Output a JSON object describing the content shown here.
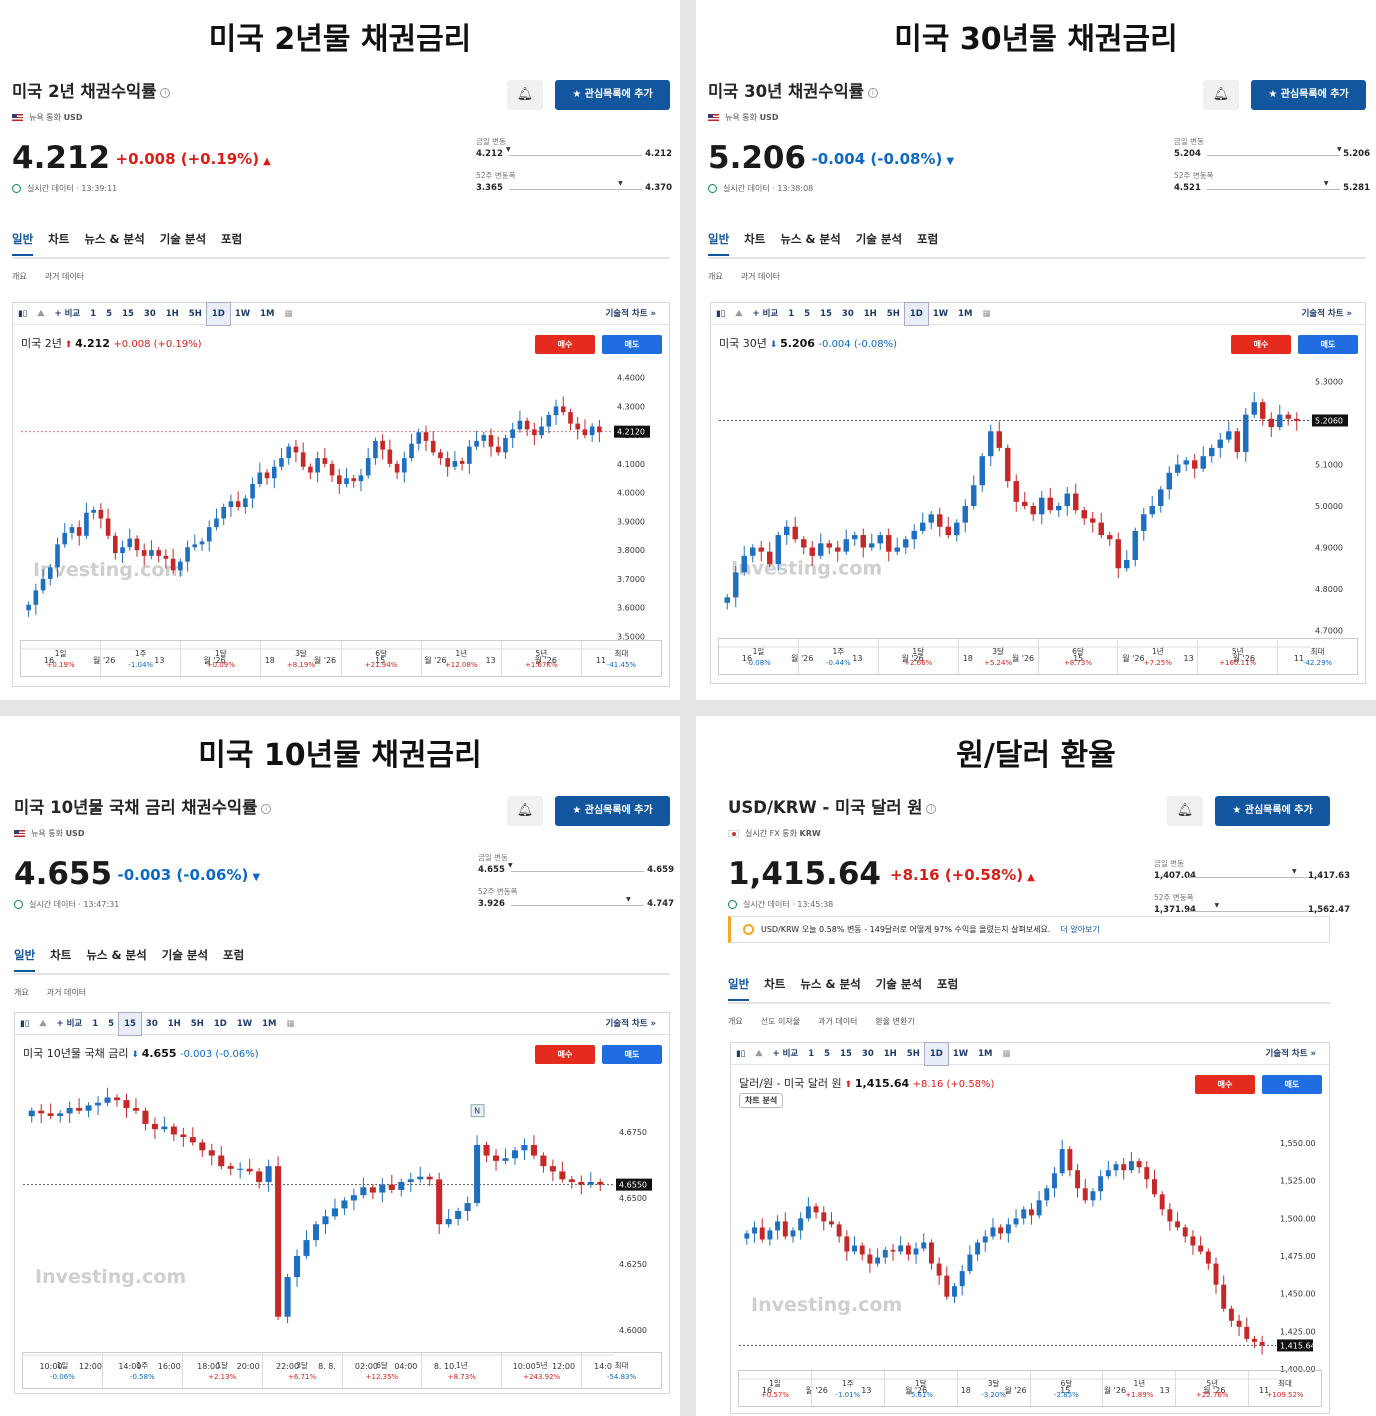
{
  "periods_labels": [
    "1일",
    "1주",
    "1달",
    "3달",
    "6달",
    "1년",
    "5년",
    "최대"
  ],
  "colors": {
    "up": "#d91e18",
    "down": "#0d69c4",
    "candle_up": "#1f6fbf",
    "candle_down": "#c62828",
    "accent": "#1256a0"
  },
  "common": {
    "currency_label": "통화",
    "daily_range_label": "금일 변동",
    "week52_label": "52주 변동폭",
    "watchlist_btn": "관심목록에 추가",
    "tabs": [
      "일반",
      "차트",
      "뉴스 & 분석",
      "기술 분석",
      "포럼"
    ],
    "subtabs": [
      "개요",
      "과거 데이터"
    ],
    "sell": "매수",
    "buy": "매도",
    "compare": "+ 비교",
    "tech_chart": "기술적 차트 »",
    "watermark": "Investing.com",
    "time_buttons": [
      "1",
      "5",
      "15",
      "30",
      "1H",
      "5H",
      "1D",
      "1W",
      "1M"
    ]
  },
  "panels": [
    {
      "section_title": "미국 2년물 채권금리",
      "name": "미국 2년 채권수익률",
      "exchange": "뉴욕",
      "currency": "USD",
      "price": "4.212",
      "change": "+0.008",
      "change_pct": "(+0.19%)",
      "direction": "up",
      "status": "실시간 데이터 · 13:39:11",
      "day_low": "4.212",
      "day_high": "4.212",
      "w52_low": "3.365",
      "w52_high": "4.370",
      "legend_name": "미국 2년",
      "legend_price": "4.212",
      "legend_change": "+0.008 (+0.19%)",
      "selected_interval": "1D",
      "periods": [
        "+0.19%",
        "-1.04%",
        "+0.09%",
        "+8.19%",
        "+21.94%",
        "+12.08%",
        "+1.67K%",
        "-41.45%"
      ],
      "chart_data": {
        "type": "candlestick",
        "interval": "1D",
        "yticks": [
          "4.4000",
          "4.3000",
          "4.2000",
          "4.1000",
          "4.0000",
          "3.9000",
          "3.8000",
          "3.7000",
          "3.6000",
          "3.5000"
        ],
        "ylim": [
          3.47,
          4.43
        ],
        "xticks": [
          "16",
          "월 '26",
          "13",
          "월 '26",
          "18",
          "월 '26",
          "15",
          "월 '26",
          "13",
          "월 '26",
          "11"
        ],
        "last_label": "4.2120",
        "last": 4.212,
        "close": [
          3.61,
          3.66,
          3.7,
          3.74,
          3.82,
          3.86,
          3.88,
          3.85,
          3.93,
          3.94,
          3.91,
          3.85,
          3.79,
          3.81,
          3.84,
          3.8,
          3.78,
          3.8,
          3.78,
          3.77,
          3.73,
          3.76,
          3.81,
          3.82,
          3.83,
          3.88,
          3.91,
          3.95,
          3.97,
          3.95,
          3.98,
          4.03,
          4.07,
          4.05,
          4.09,
          4.12,
          4.16,
          4.14,
          4.09,
          4.07,
          4.12,
          4.1,
          4.06,
          4.03,
          4.05,
          4.04,
          4.06,
          4.12,
          4.18,
          4.15,
          4.1,
          4.07,
          4.12,
          4.17,
          4.21,
          4.18,
          4.14,
          4.12,
          4.09,
          4.11,
          4.1,
          4.16,
          4.18,
          4.2,
          4.16,
          4.14,
          4.19,
          4.22,
          4.25,
          4.22,
          4.2,
          4.23,
          4.27,
          4.3,
          4.28,
          4.24,
          4.22,
          4.2,
          4.23,
          4.21
        ]
      }
    },
    {
      "section_title": "미국 30년물 채권금리",
      "name": "미국 30년 채권수익률",
      "exchange": "뉴욕",
      "currency": "USD",
      "price": "5.206",
      "change": "-0.004",
      "change_pct": "(-0.08%)",
      "direction": "down",
      "status": "실시간 데이터 · 13:38:08",
      "day_low": "5.204",
      "day_high": "5.206",
      "w52_low": "4.521",
      "w52_high": "5.281",
      "legend_name": "미국 30년",
      "legend_price": "5.206",
      "legend_change": "-0.004 (-0.08%)",
      "selected_interval": "1D",
      "periods": [
        "-0.08%",
        "-0.44%",
        "+2.66%",
        "+5.24%",
        "+8.73%",
        "+7.25%",
        "+160.11%",
        "-42.29%"
      ],
      "chart_data": {
        "type": "candlestick",
        "interval": "1D",
        "yticks": [
          "5.3000",
          "5.2000",
          "5.1000",
          "5.0000",
          "4.9000",
          "4.8000",
          "4.7000"
        ],
        "ylim": [
          4.67,
          5.33
        ],
        "xticks": [
          "16",
          "월 '26",
          "13",
          "월 '26",
          "18",
          "월 '26",
          "15",
          "월 '26",
          "13",
          "월 '26",
          "11"
        ],
        "last_label": "5.2060",
        "last": 5.206,
        "close": [
          4.78,
          4.84,
          4.88,
          4.9,
          4.89,
          4.86,
          4.93,
          4.95,
          4.92,
          4.9,
          4.88,
          4.91,
          4.9,
          4.89,
          4.92,
          4.93,
          4.9,
          4.91,
          4.93,
          4.89,
          4.9,
          4.92,
          4.94,
          4.96,
          4.98,
          4.95,
          4.93,
          4.96,
          5.0,
          5.05,
          5.12,
          5.18,
          5.14,
          5.06,
          5.01,
          5.0,
          4.98,
          5.02,
          4.99,
          5.0,
          5.03,
          4.99,
          4.97,
          4.96,
          4.93,
          4.92,
          4.85,
          4.87,
          4.94,
          4.98,
          5.0,
          5.04,
          5.08,
          5.1,
          5.11,
          5.09,
          5.12,
          5.14,
          5.16,
          5.18,
          5.13,
          5.22,
          5.25,
          5.21,
          5.19,
          5.22,
          5.21,
          5.205
        ]
      }
    },
    {
      "section_title": "미국 10년물 채권금리",
      "name": "미국 10년물 국채 금리 채권수익률",
      "exchange": "뉴욕",
      "currency": "USD",
      "price": "4.655",
      "change": "-0.003",
      "change_pct": "(-0.06%)",
      "direction": "down",
      "status": "실시간 데이터 · 13:47:31",
      "day_low": "4.655",
      "day_high": "4.659",
      "w52_low": "3.926",
      "w52_high": "4.747",
      "legend_name": "미국 10년물 국채 금리",
      "legend_price": "4.655",
      "legend_change": "-0.003 (-0.06%)",
      "selected_interval": "15",
      "periods": [
        "-0.06%",
        "-0.58%",
        "+2.13%",
        "+6.71%",
        "+12.35%",
        "+8.73%",
        "+243.92%",
        "-54.83%"
      ],
      "chart_data": {
        "type": "candlestick",
        "interval": "15",
        "yticks": [
          "4.6750",
          "4.6500",
          "4.6250",
          "4.6000"
        ],
        "ylim": [
          4.592,
          4.695
        ],
        "xticks": [
          "10:00",
          "12:00",
          "14:00",
          "16:00",
          "18:00",
          "20:00",
          "22:00",
          "8. 8.",
          "02:00",
          "04:00",
          "8. 10.",
          "",
          "10:00",
          "12:00",
          "14:0"
        ],
        "last_label": "4.6550",
        "last": 4.655,
        "news_marker": "N",
        "close": [
          4.683,
          4.682,
          4.681,
          4.682,
          4.684,
          4.683,
          4.685,
          4.686,
          4.688,
          4.687,
          4.684,
          4.683,
          4.678,
          4.676,
          4.677,
          4.674,
          4.673,
          4.671,
          4.668,
          4.666,
          4.662,
          4.661,
          4.661,
          4.66,
          4.656,
          4.662,
          4.605,
          4.62,
          4.628,
          4.634,
          4.64,
          4.643,
          4.646,
          4.649,
          4.651,
          4.654,
          4.652,
          4.655,
          4.653,
          4.656,
          4.657,
          4.658,
          4.657,
          4.64,
          4.642,
          4.645,
          4.648,
          4.67,
          4.666,
          4.664,
          4.665,
          4.668,
          4.67,
          4.666,
          4.662,
          4.66,
          4.657,
          4.656,
          4.655,
          4.656,
          4.655
        ]
      }
    },
    {
      "section_title": "원/달러 환율",
      "name": "USD/KRW - 미국 달러 원",
      "exchange": "실시간 FX",
      "currency": "KRW",
      "price": "1,415.64",
      "change": "+8.16",
      "change_pct": "(+0.58%)",
      "direction": "up",
      "status": "실시간 데이터 · 13:45:38",
      "day_low": "1,407.04",
      "day_high": "1,417.63",
      "w52_low": "1,371.94",
      "w52_high": "1,562.47",
      "legend_name": "달러/원 - 미국 달러 원",
      "legend_price": "1,415.64",
      "legend_change": "+8.16 (+0.58%)",
      "selected_interval": "1D",
      "ai_label": "차트 분석",
      "notice": "USD/KRW 오늘 0.58% 변동 - 149달러로 어떻게 97% 수익을 올렸는지 살펴보세요.",
      "notice_more": "더 알아보기",
      "subtabs": [
        "개요",
        "선도 이자율",
        "과거 데이터",
        "환율 변환기"
      ],
      "periods": [
        "+0.57%",
        "-1.01%",
        "-5.61%",
        "-3.20%",
        "-2.85%",
        "+1.89%",
        "+22.76%",
        "+109.52%"
      ],
      "chart_data": {
        "type": "candlestick",
        "interval": "1D",
        "yticks": [
          "1,550.00",
          "1,525.00",
          "1,500.00",
          "1,475.00",
          "1,450.00",
          "1,425.00",
          "1,400.00"
        ],
        "ylim": [
          1396,
          1566
        ],
        "xticks": [
          "16",
          "월 '26",
          "13",
          "월 '26",
          "18",
          "월 '26",
          "15",
          "월 '26",
          "13",
          "월 '26",
          "11"
        ],
        "last_label": "1,415.64",
        "last": 1415.64,
        "close": [
          1490,
          1494,
          1486,
          1492,
          1498,
          1488,
          1492,
          1500,
          1508,
          1504,
          1498,
          1496,
          1488,
          1478,
          1482,
          1476,
          1470,
          1474,
          1479,
          1478,
          1482,
          1476,
          1480,
          1484,
          1470,
          1462,
          1448,
          1455,
          1465,
          1476,
          1484,
          1488,
          1494,
          1490,
          1496,
          1500,
          1506,
          1502,
          1512,
          1520,
          1530,
          1546,
          1532,
          1520,
          1512,
          1518,
          1528,
          1532,
          1536,
          1532,
          1538,
          1534,
          1526,
          1516,
          1506,
          1498,
          1494,
          1488,
          1482,
          1478,
          1470,
          1456,
          1440,
          1432,
          1428,
          1420,
          1418,
          1415.64
        ]
      }
    }
  ]
}
